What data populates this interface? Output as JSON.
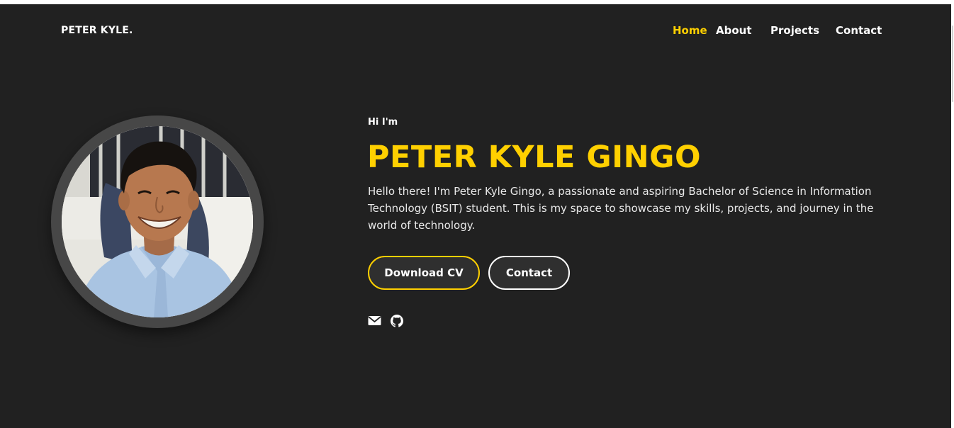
{
  "header": {
    "brand": "PETER KYLE.",
    "nav": [
      {
        "label": "Home",
        "active": true
      },
      {
        "label": "About",
        "active": false
      },
      {
        "label": "Projects",
        "active": false
      },
      {
        "label": "Contact",
        "active": false
      }
    ]
  },
  "hero": {
    "greeting": "Hi I'm",
    "name": "PETER KYLE GINGO",
    "intro": "Hello there! I'm Peter Kyle Gingo, a passionate and aspiring Bachelor of Science in Information Technology (BSIT) student. This is my space to showcase my skills, projects, and journey in the world of technology.",
    "buttons": {
      "download_cv": "Download CV",
      "contact": "Contact"
    },
    "social_icons": [
      "envelope-icon",
      "github-icon"
    ]
  },
  "colors": {
    "background": "#212121",
    "accent": "#ffd000",
    "text": "#ffffff",
    "avatar_ring": "#474747"
  }
}
